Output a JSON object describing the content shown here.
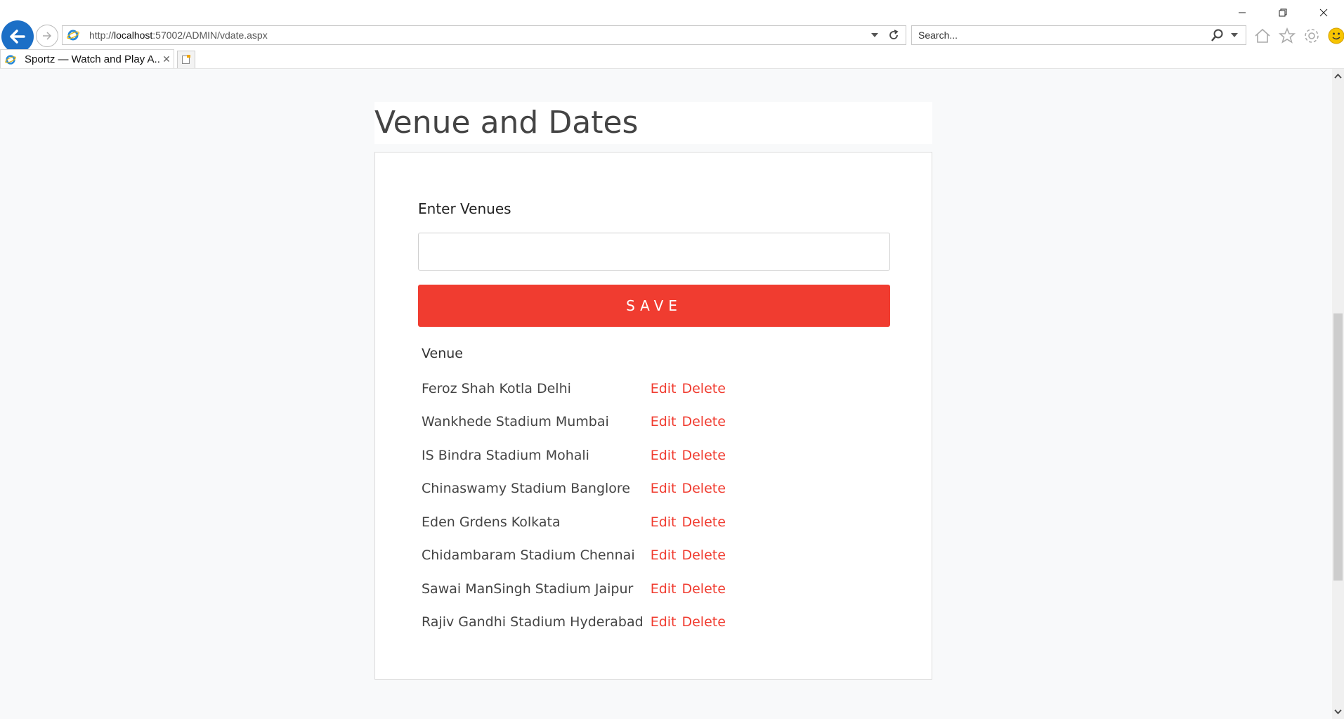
{
  "browser": {
    "url_prefix": "http://",
    "url_host": "localhost",
    "url_rest": ":57002/ADMIN/vdate.aspx",
    "search_placeholder": "Search...",
    "tab_title": "Sportz — Watch and Play A...",
    "tab_close": "✕",
    "icons": [
      "back-arrow-icon",
      "forward-arrow-icon",
      "ie-logo-icon",
      "refresh-icon",
      "search-icon",
      "home-icon",
      "star-icon",
      "gear-icon",
      "smiley-icon"
    ]
  },
  "page": {
    "title": "Venue and Dates",
    "form_label": "Enter Venues",
    "input_value": "",
    "save_label": "SAVE",
    "table_header": "Venue",
    "edit_label": "Edit",
    "delete_label": "Delete",
    "venues": [
      "Feroz Shah Kotla Delhi",
      "Wankhede Stadium Mumbai",
      "IS Bindra Stadium Mohali",
      "Chinaswamy Stadium Banglore",
      "Eden Grdens Kolkata",
      "Chidambaram Stadium Chennai",
      "Sawai ManSingh Stadium Jaipur",
      "Rajiv Gandhi Stadium Hyderabad"
    ]
  },
  "colors": {
    "accent": "#f03c30",
    "background": "#f8f9fa",
    "ie_blue": "#1c6fc6"
  }
}
